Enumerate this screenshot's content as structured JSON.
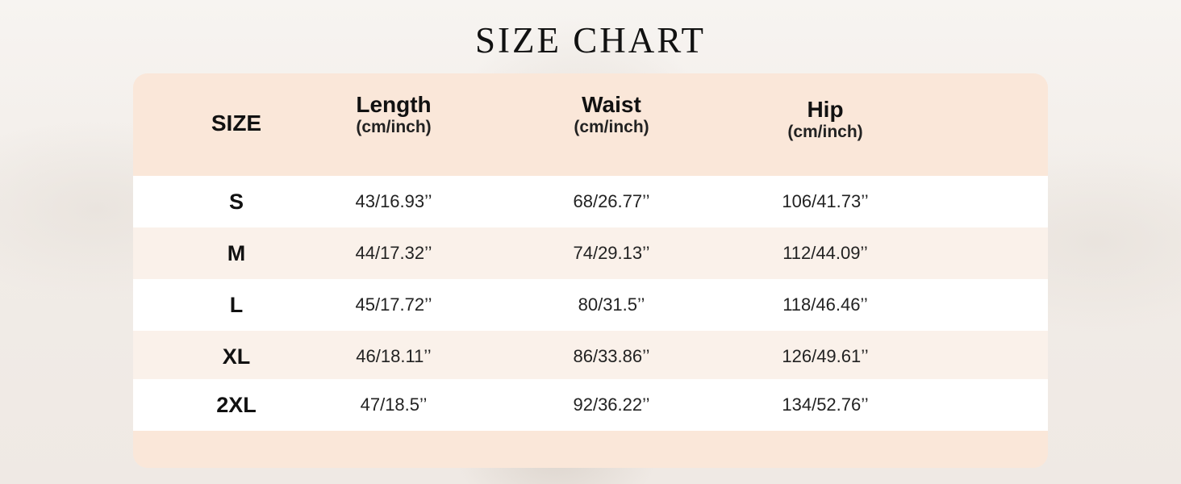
{
  "title": "SIZE CHART",
  "colors": {
    "header_bg": "#fae7d9",
    "row_white": "#ffffff",
    "row_tint": "#faf1ea",
    "text": "#111111"
  },
  "table": {
    "headers": [
      {
        "main": "SIZE",
        "sub": ""
      },
      {
        "main": "Length",
        "sub": "(cm/inch)"
      },
      {
        "main": "Waist",
        "sub": "(cm/inch)"
      },
      {
        "main": "Hip",
        "sub": "(cm/inch)"
      }
    ],
    "rows": [
      {
        "size": "S",
        "length": "43/16.93’’",
        "waist": "68/26.77’’",
        "hip": "106/41.73’’"
      },
      {
        "size": "M",
        "length": "44/17.32’’",
        "waist": "74/29.13’’",
        "hip": "112/44.09’’"
      },
      {
        "size": "L",
        "length": "45/17.72’’",
        "waist": "80/31.5’’",
        "hip": "118/46.46’’"
      },
      {
        "size": "XL",
        "length": "46/18.11’’",
        "waist": "86/33.86’’",
        "hip": "126/49.61’’"
      },
      {
        "size": "2XL",
        "length": "47/18.5’’",
        "waist": "92/36.22’’",
        "hip": "134/52.76’’"
      }
    ]
  }
}
